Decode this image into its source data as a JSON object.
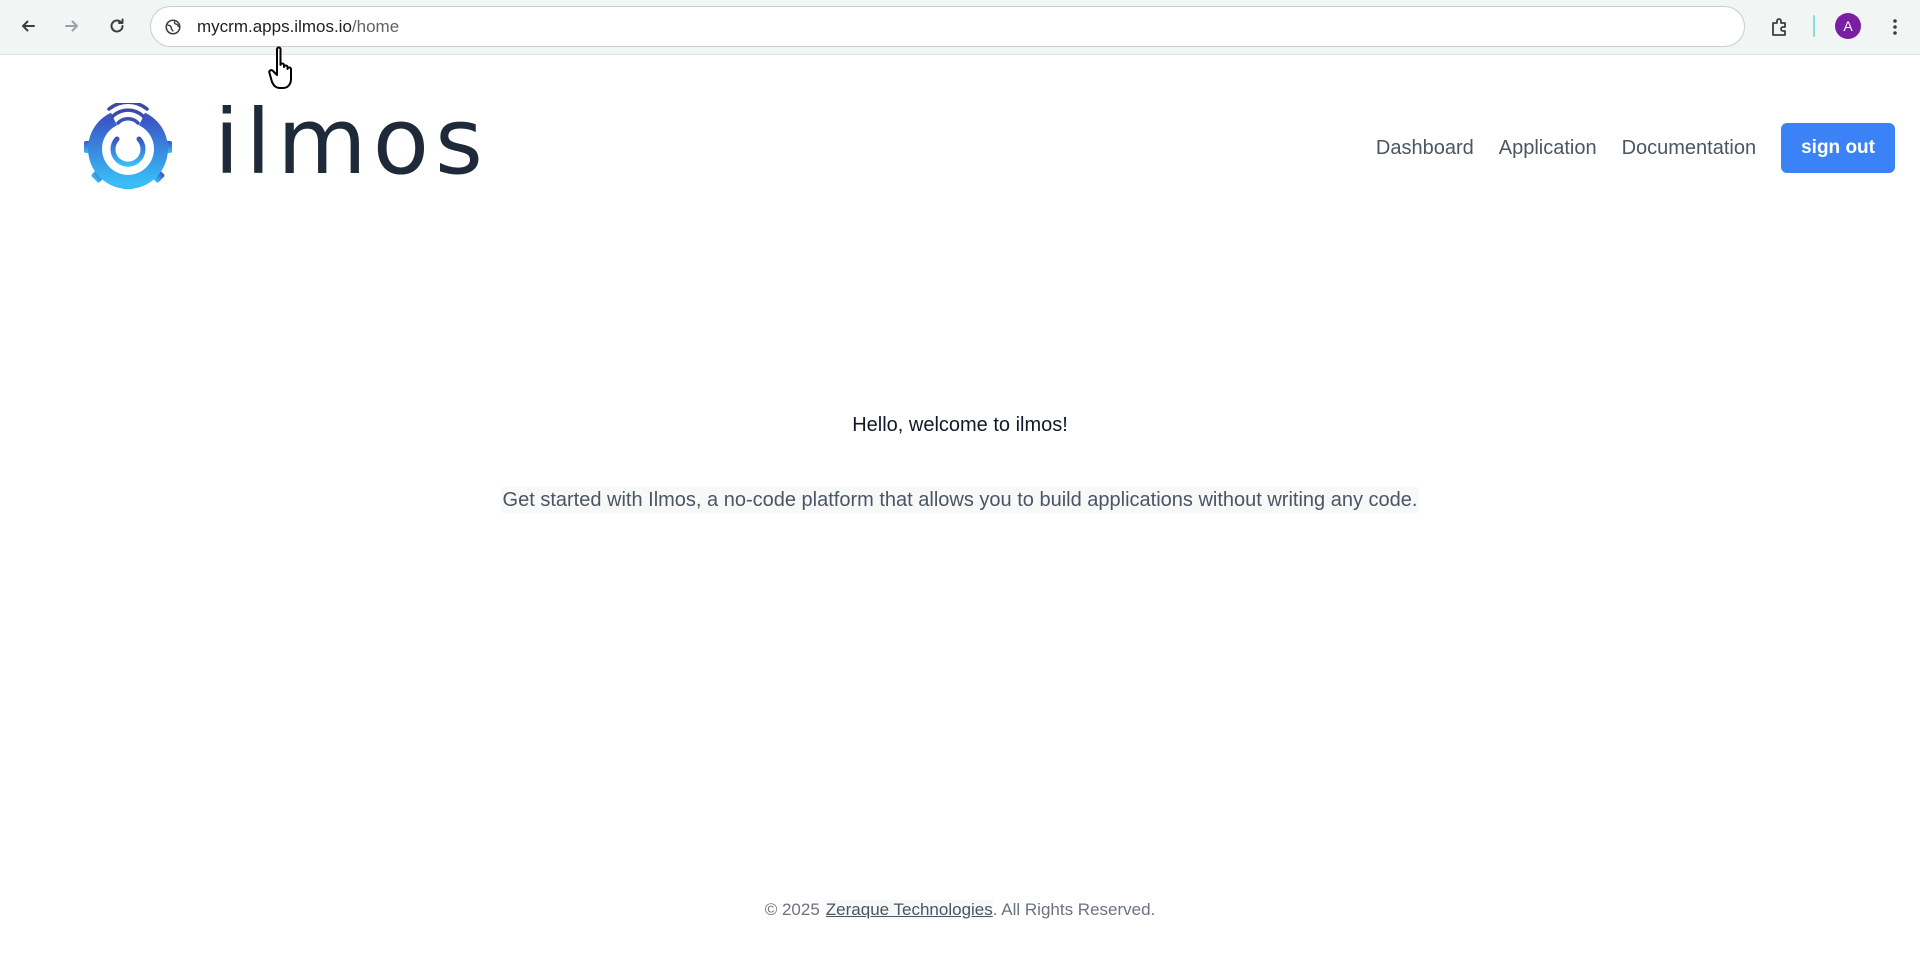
{
  "browser": {
    "url_host": "mycrm.apps.ilmos.io",
    "url_path": "/home",
    "profile_initial": "A",
    "icons": {
      "back": "arrow-left-icon",
      "forward": "arrow-right-icon",
      "reload": "reload-icon",
      "site_info": "site-info-icon",
      "extensions": "puzzle-icon",
      "menu": "kebab-menu-icon"
    }
  },
  "header": {
    "brand": "ilmos",
    "nav": [
      {
        "label": "Dashboard"
      },
      {
        "label": "Application"
      },
      {
        "label": "Documentation"
      }
    ],
    "signout_label": "sign out"
  },
  "main": {
    "welcome": "Hello, welcome to ilmos!",
    "tagline": "Get started with Ilmos, a no-code platform that allows you to build applications without writing any code."
  },
  "footer": {
    "copyright": "© 2025",
    "company_link": "Zeraque Technologies",
    "rights": ". All Rights Reserved."
  },
  "colors": {
    "accent": "#3b82f6",
    "avatar": "#7b1fa2",
    "brand_text": "#1e2a3a"
  }
}
